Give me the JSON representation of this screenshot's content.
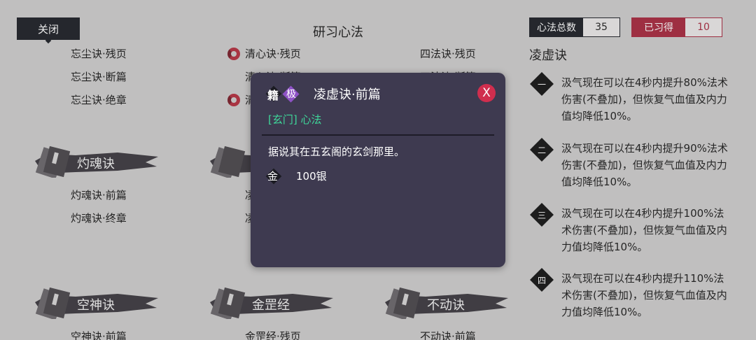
{
  "header": {
    "close_label": "关闭",
    "title": "研习心法",
    "total_label": "心法总数",
    "total_value": "35",
    "learned_label": "已习得",
    "learned_value": "10"
  },
  "columns": {
    "col1_top": [
      "忘尘诀·残页",
      "忘尘诀·断篇",
      "忘尘诀·绝章"
    ],
    "col2_top": [
      "清心诀·残页",
      "清心诀·断篇",
      "清"
    ],
    "col3_top": [
      "四法诀·残页",
      "四法诀·断篇"
    ],
    "col1_mid_header": "灼魂诀",
    "col1_mid": [
      "灼魂诀·前篇",
      "灼魂诀·终章"
    ],
    "col2_mid": [
      "凌",
      "凌"
    ],
    "bottom_headers": [
      "空神诀",
      "金罡经",
      "不动诀"
    ],
    "bottom_entries": [
      "空神诀·前篇",
      "金罡经·残页",
      "不动诀·前篇"
    ]
  },
  "detail": {
    "title": "凌虚诀",
    "levels": [
      {
        "num": "一",
        "text": "汲气现在可以在4秒内提升80%法术伤害(不叠加)，但恢复气血值及内力值均降低10%。"
      },
      {
        "num": "二",
        "text": "汲气现在可以在4秒内提升90%法术伤害(不叠加)，但恢复气血值及内力值均降低10%。"
      },
      {
        "num": "三",
        "text": "汲气现在可以在4秒内提升100%法术伤害(不叠加)，但恢复气血值及内力值均降低10%。"
      },
      {
        "num": "四",
        "text": "汲气现在可以在4秒内提升110%法术伤害(不叠加)，但恢复气血值及内力值均降低10%。"
      }
    ]
  },
  "popup": {
    "book_tag": "籍",
    "rank": "极",
    "name": "凌虚诀·前篇",
    "close_label": "X",
    "category": "[玄门] 心法",
    "description": "据说其在五玄阁的玄剑那里。",
    "price_icon": "金",
    "price": "100银"
  },
  "colors": {
    "background": "#cfcdcd",
    "popup_bg": "#3e3a50",
    "accent_red": "#a82a3f",
    "category_green": "#3ed79a",
    "rank_purple": "#8e52c6"
  }
}
